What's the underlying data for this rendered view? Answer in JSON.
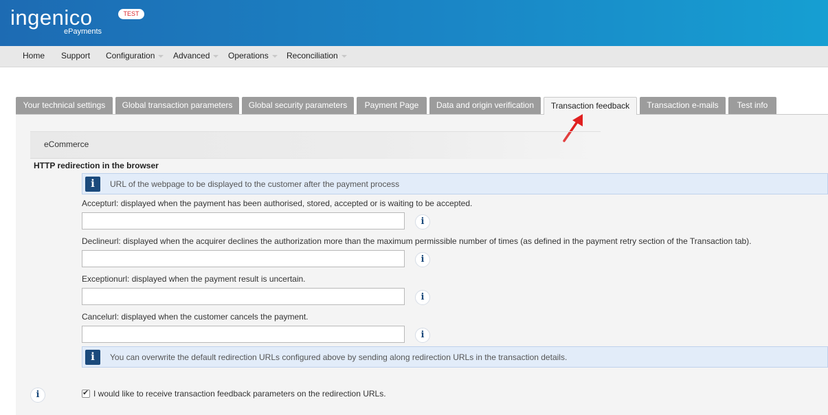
{
  "header": {
    "logo_main": "ingenico",
    "logo_sub": "ePayments",
    "env_badge": "TEST"
  },
  "nav": {
    "items": [
      {
        "label": "Home",
        "has_dropdown": false
      },
      {
        "label": "Support",
        "has_dropdown": false
      },
      {
        "label": "Configuration",
        "has_dropdown": true
      },
      {
        "label": "Advanced",
        "has_dropdown": true
      },
      {
        "label": "Operations",
        "has_dropdown": true
      },
      {
        "label": "Reconciliation",
        "has_dropdown": true
      }
    ]
  },
  "tabs": [
    {
      "label": "Your technical settings"
    },
    {
      "label": "Global transaction parameters"
    },
    {
      "label": "Global security parameters"
    },
    {
      "label": "Payment Page"
    },
    {
      "label": "Data and origin verification"
    },
    {
      "label": "Transaction feedback",
      "active": true
    },
    {
      "label": "Transaction e-mails"
    },
    {
      "label": "Test info"
    }
  ],
  "content": {
    "section_title": "eCommerce",
    "subheading": "HTTP redirection in the browser",
    "info_top": "URL of the webpage to be displayed to the customer after the payment process",
    "fields": [
      {
        "label": "Accepturl: displayed when the payment has been authorised, stored, accepted or is waiting to be accepted.",
        "value": ""
      },
      {
        "label": "Declineurl: displayed when the acquirer declines the authorization more than the maximum permissible number of times (as defined in the payment retry section of the Transaction tab).",
        "value": ""
      },
      {
        "label": "Exceptionurl: displayed when the payment result is uncertain.",
        "value": ""
      },
      {
        "label": "Cancelurl: displayed when the customer cancels the payment.",
        "value": ""
      }
    ],
    "info_bottom": "You can overwrite the default redirection URLs configured above by sending along redirection URLs in the transaction details.",
    "checkbox_label": "I would like to receive transaction feedback parameters on the redirection URLs.",
    "checkbox_checked": true,
    "info_glyph": "i",
    "check_glyph": "✔"
  },
  "colors": {
    "header_start": "#1d6bb3",
    "header_end": "#169fd2",
    "tab_inactive": "#9c9c9c",
    "info_dark": "#1b4a7c",
    "annotation_arrow": "#e02020"
  }
}
